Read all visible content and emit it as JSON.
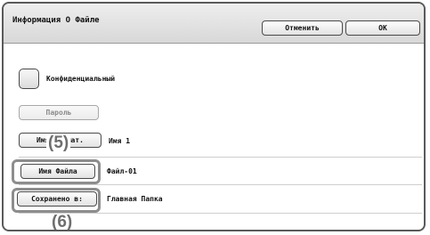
{
  "dialog": {
    "title": "Информация О Файле",
    "cancel_label": "Отменить",
    "ok_label": "OK"
  },
  "confidential": {
    "label": "Конфиденциальный",
    "checked": false
  },
  "password_label": "Пароль",
  "rows": {
    "format": {
      "button": "Имя Формат.",
      "value": "Имя 1"
    },
    "file_name": {
      "button": "Имя Файла",
      "value": "Файл-01"
    },
    "saved_to": {
      "button": "Сохранено в:",
      "value": "Главная Папка"
    }
  },
  "callouts": {
    "five": "(5)",
    "six": "(6)"
  }
}
